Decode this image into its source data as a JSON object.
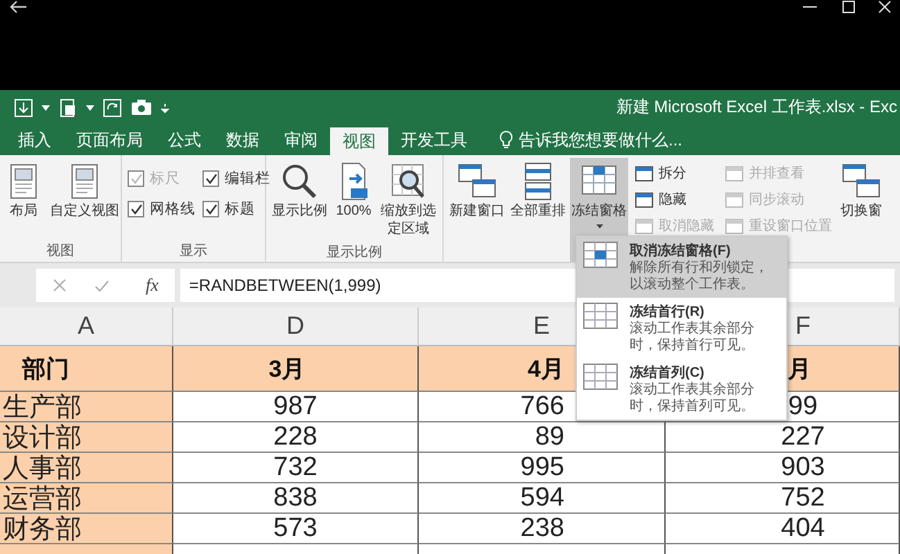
{
  "title_bar": {
    "title": "新建 Microsoft Excel 工作表.xlsx - Exc"
  },
  "tabs": [
    {
      "label": "插入",
      "selected": false
    },
    {
      "label": "页面布局",
      "selected": false
    },
    {
      "label": "公式",
      "selected": false
    },
    {
      "label": "数据",
      "selected": false
    },
    {
      "label": "审阅",
      "selected": false
    },
    {
      "label": "视图",
      "selected": true
    },
    {
      "label": "开发工具",
      "selected": false
    }
  ],
  "tell_me": {
    "placeholder": "告诉我您想要做什么..."
  },
  "ribbon": {
    "groups": [
      {
        "label": "视图",
        "items": [
          {
            "kind": "large",
            "label": "布局",
            "disabled": false,
            "pressed": false
          },
          {
            "kind": "large",
            "label": "自定义视图",
            "disabled": false,
            "pressed": false
          }
        ]
      },
      {
        "label": "显示",
        "items": [
          {
            "kind": "checkbox",
            "label": "标尺",
            "checked": true,
            "disabled": true
          },
          {
            "kind": "checkbox",
            "label": "编辑栏",
            "checked": true,
            "disabled": false
          },
          {
            "kind": "checkbox",
            "label": "网格线",
            "checked": true,
            "disabled": false
          },
          {
            "kind": "checkbox",
            "label": "标题",
            "checked": true,
            "disabled": false
          }
        ]
      },
      {
        "label": "显示比例",
        "items": [
          {
            "kind": "large",
            "label": "显示比例",
            "disabled": false,
            "pressed": false
          },
          {
            "kind": "large",
            "label": "100%",
            "disabled": false,
            "pressed": false
          },
          {
            "kind": "large",
            "label": "缩放到选定区域",
            "disabled": false,
            "pressed": false
          }
        ]
      },
      {
        "items": [
          {
            "kind": "large",
            "label": "新建窗口",
            "disabled": false,
            "pressed": false
          },
          {
            "kind": "large",
            "label": "全部重排",
            "disabled": false,
            "pressed": false
          },
          {
            "kind": "large",
            "label": "冻结窗格",
            "disabled": false,
            "pressed": true
          },
          {
            "kind": "small",
            "label": "拆分",
            "disabled": false
          },
          {
            "kind": "small",
            "label": "隐藏",
            "disabled": false
          },
          {
            "kind": "small",
            "label": "取消隐藏",
            "disabled": true
          },
          {
            "kind": "small",
            "label": "并排查看",
            "disabled": true
          },
          {
            "kind": "small",
            "label": "同步滚动",
            "disabled": true
          },
          {
            "kind": "small",
            "label": "重设窗口位置",
            "disabled": true
          },
          {
            "kind": "large",
            "label": "切换窗",
            "disabled": false,
            "pressed": false
          }
        ]
      }
    ]
  },
  "formula_bar": {
    "function_button": "fx",
    "formula": "=RANDBETWEEN(1,999)"
  },
  "sheet": {
    "columns": [
      "A",
      "D",
      "E",
      "F"
    ],
    "header": [
      "部门",
      "3月",
      "4月",
      "月"
    ],
    "rows": [
      [
        "生产部",
        "987",
        "766",
        "99"
      ],
      [
        "设计部",
        "228",
        "89",
        "227"
      ],
      [
        "人事部",
        "732",
        "995",
        "903"
      ],
      [
        "运营部",
        "838",
        "594",
        "752"
      ],
      [
        "财务部",
        "573",
        "238",
        "404"
      ]
    ]
  },
  "freeze_menu": {
    "items": [
      {
        "title": "取消冻结窗格(F)",
        "description": "解除所有行和列锁定，以滚动整个工作表。",
        "selected": true
      },
      {
        "title": "冻结首行(R)",
        "description": "滚动工作表其余部分时，保持首行可见。",
        "selected": false
      },
      {
        "title": "冻结首列(C)",
        "description": "滚动工作表其余部分时，保持首列可见。",
        "selected": false
      }
    ]
  }
}
